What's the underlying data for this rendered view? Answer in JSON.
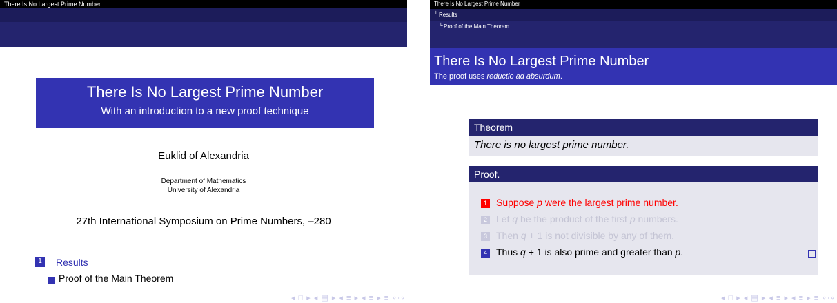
{
  "left_slide": {
    "headline": "There Is No Largest Prime Number",
    "title": "There Is No Largest Prime Number",
    "subtitle": "With an introduction to a new proof technique",
    "author": "Euklid of Alexandria",
    "institute_line1": "Department of Mathematics",
    "institute_line2": "University of Alexandria",
    "date": "27th International Symposium on Prime Numbers, –280",
    "toc": {
      "section_number": "1",
      "section": "Results",
      "subsection": "Proof of the Main Theorem"
    }
  },
  "right_slide": {
    "headline_title": "There Is No Largest Prime Number",
    "headline_section": "Results",
    "headline_subsection": "Proof of the Main Theorem",
    "frame_title": "There Is No Largest Prime Number",
    "frame_subtitle_prefix": "The proof uses ",
    "frame_subtitle_emph": "reductio ad absurdum",
    "frame_subtitle_suffix": ".",
    "theorem_title": "Theorem",
    "theorem_text": "There is no largest prime number.",
    "proof_title": "Proof.",
    "items": [
      {
        "num": "1",
        "a": "Suppose ",
        "m1": "p",
        "b": " were the largest prime number.",
        "m2": "",
        "c": ""
      },
      {
        "num": "2",
        "a": "Let ",
        "m1": "q",
        "b": " be the product of the first ",
        "m2": "p",
        "c": " numbers."
      },
      {
        "num": "3",
        "a": "Then ",
        "m1": "q",
        "b": " + 1 is not divisible by any of them.",
        "m2": "",
        "c": ""
      },
      {
        "num": "4",
        "a": "Thus ",
        "m1": "q",
        "b": " + 1 is also prime and greater than ",
        "m2": "p",
        "c": "."
      }
    ]
  },
  "navigation_symbols": "◂ □ ▸ ◂ ▤ ▸ ◂ ≡ ▸ ◂ ≡ ▸ ≡ ∘∙∘"
}
